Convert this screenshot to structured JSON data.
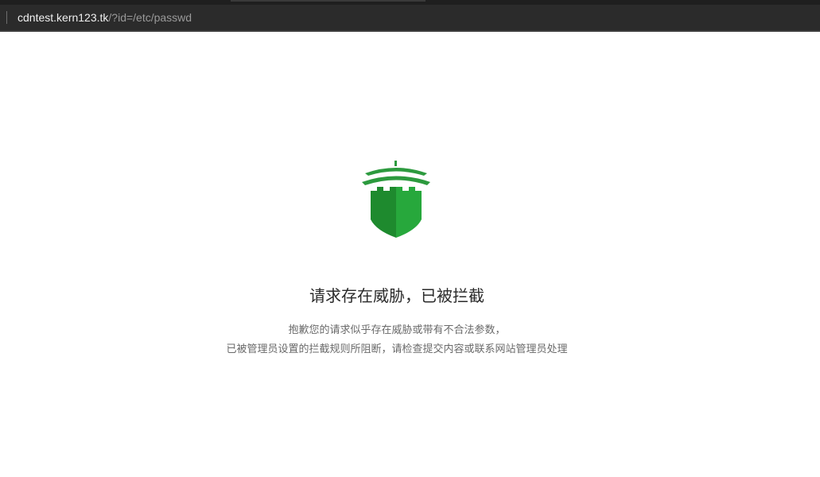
{
  "browser": {
    "url_host": "cdntest.kern123.tk",
    "url_path": "/?id=/etc/passwd"
  },
  "block_page": {
    "icon": "castle-shield-icon",
    "accent_colors": [
      "#1e8a2e",
      "#27a83c"
    ],
    "title": "请求存在威胁，已被拦截",
    "description_line1": "抱歉您的请求似乎存在威胁或带有不合法参数，",
    "description_line2": "已被管理员设置的拦截规则所阻断，请检查提交内容或联系网站管理员处理"
  }
}
